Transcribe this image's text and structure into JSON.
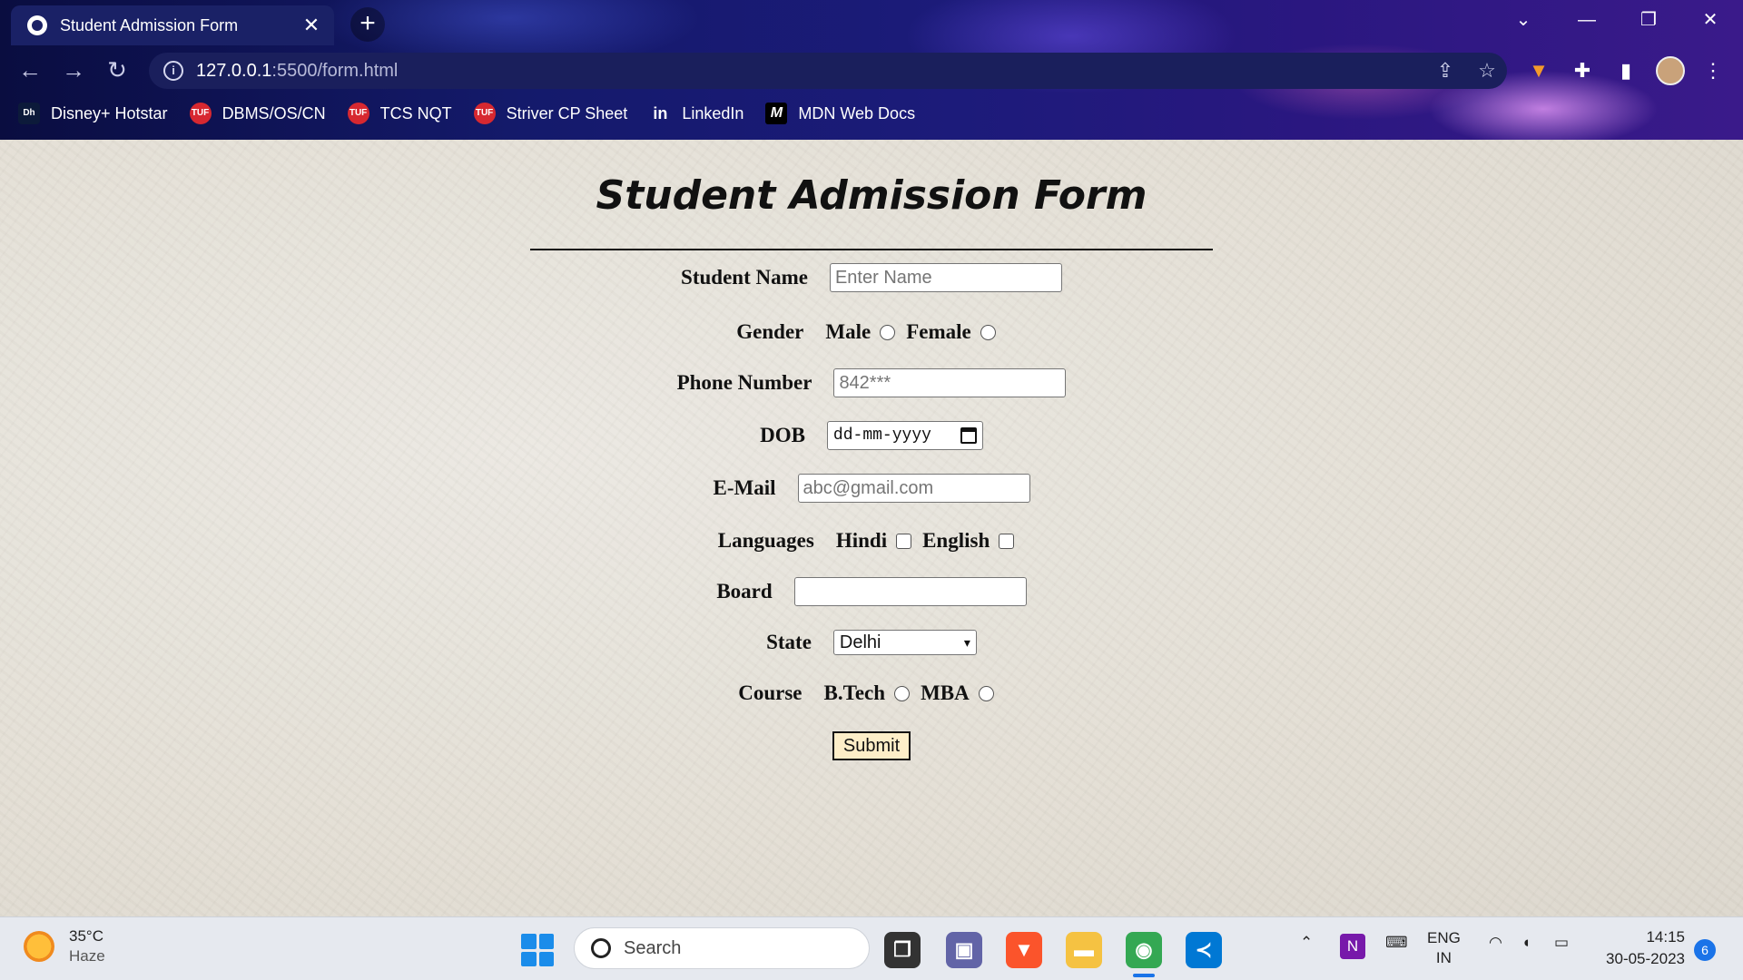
{
  "browser": {
    "tab_title": "Student Admission Form",
    "tab_close": "✕",
    "new_tab": "+",
    "url_host": "127.0.0.1",
    "url_path": ":5500/form.html",
    "window_controls": [
      "⌄",
      "—",
      "❐",
      "✕"
    ],
    "bookmarks": [
      {
        "label": "Disney+ Hotstar",
        "icon": "hotstar-icon"
      },
      {
        "label": "DBMS/OS/CN",
        "icon": "tuf-icon"
      },
      {
        "label": "TCS NQT",
        "icon": "tuf-icon"
      },
      {
        "label": "Striver CP Sheet",
        "icon": "tuf-icon"
      },
      {
        "label": "LinkedIn",
        "icon": "linkedin-icon"
      },
      {
        "label": "MDN Web Docs",
        "icon": "mdn-icon"
      }
    ]
  },
  "form": {
    "title": "Student Admission Form",
    "student_name_label": "Student Name",
    "student_name_placeholder": "Enter Name",
    "gender_label": "Gender",
    "gender_options": [
      "Male",
      "Female"
    ],
    "phone_label": "Phone Number",
    "phone_placeholder": "842***",
    "dob_label": "DOB",
    "dob_placeholder": "dd-mm-yyyy",
    "email_label": "E-Mail",
    "email_placeholder": "abc@gmail.com",
    "languages_label": "Languages",
    "language_options": [
      "Hindi",
      "English"
    ],
    "board_label": "Board",
    "board_value": "",
    "state_label": "State",
    "state_selected": "Delhi",
    "course_label": "Course",
    "course_options": [
      "B.Tech",
      "MBA"
    ],
    "submit_label": "Submit"
  },
  "taskbar": {
    "temperature": "35°C",
    "weather": "Haze",
    "search_label": "Search",
    "language_top": "ENG",
    "language_bottom": "IN",
    "time": "14:15",
    "date": "30-05-2023",
    "notification_count": "6"
  }
}
